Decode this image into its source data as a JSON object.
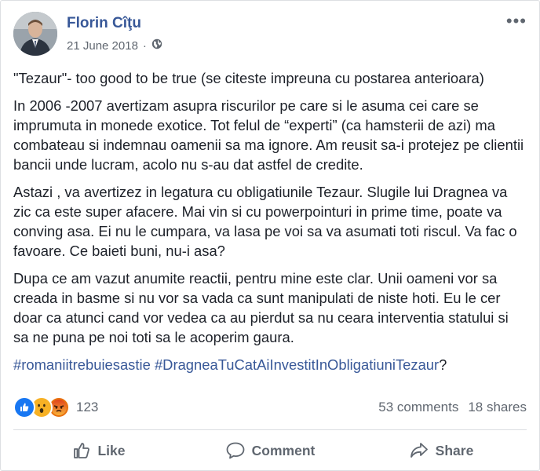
{
  "post": {
    "author": "Florin Cîţu",
    "date": "21 June 2018",
    "separator": "·",
    "more_label": "•••",
    "paragraphs": [
      "\"Tezaur\"- too good to be true (se citeste impreuna cu postarea anterioara)",
      "In 2006 -2007 avertizam asupra riscurilor pe care si le asuma cei care se imprumuta in monede exotice. Tot felul de “experti” (ca hamsterii de azi) ma combateau si indemnau oamenii sa ma ignore. Am reusit sa-i protejez pe clientii bancii unde lucram, acolo nu s-au dat astfel de credite.",
      "Astazi , va avertizez in legatura cu obligatiunile Tezaur. Slugile lui Dragnea va zic ca este super afacere. Mai vin si cu powerpointuri in prime time, poate va conving asa. Ei nu le cumpara, va lasa pe voi sa va asumati toti riscul. Va fac o favoare. Ce baieti buni, nu-i asa?",
      "Dupa ce am vazut anumite reactii, pentru mine este clar. Unii oameni vor sa creada in basme si nu vor sa vada ca sunt manipulati de niste hoti. Eu le cer doar ca atunci cand vor vedea ca au pierdut sa nu ceara interventia statului si sa ne puna pe noi toti sa le acoperim gaura."
    ],
    "hashtags": [
      "#romaniitrebuiesastie",
      "#DragneaTuCatAiInvestitInObligatiuniTezaur"
    ],
    "hashtag_suffix": "?"
  },
  "stats": {
    "reaction_count": "123",
    "comments": "53 comments",
    "shares": "18 shares",
    "reactions": [
      "like-reaction",
      "wow-reaction",
      "angry-reaction"
    ]
  },
  "actions": {
    "like": "Like",
    "comment": "Comment",
    "share": "Share"
  },
  "colors": {
    "link": "#385898",
    "text": "#1d2129",
    "muted": "#606770",
    "like_blue": "#1877f2",
    "angry": "#e9710f",
    "wow": "#f7b125"
  }
}
